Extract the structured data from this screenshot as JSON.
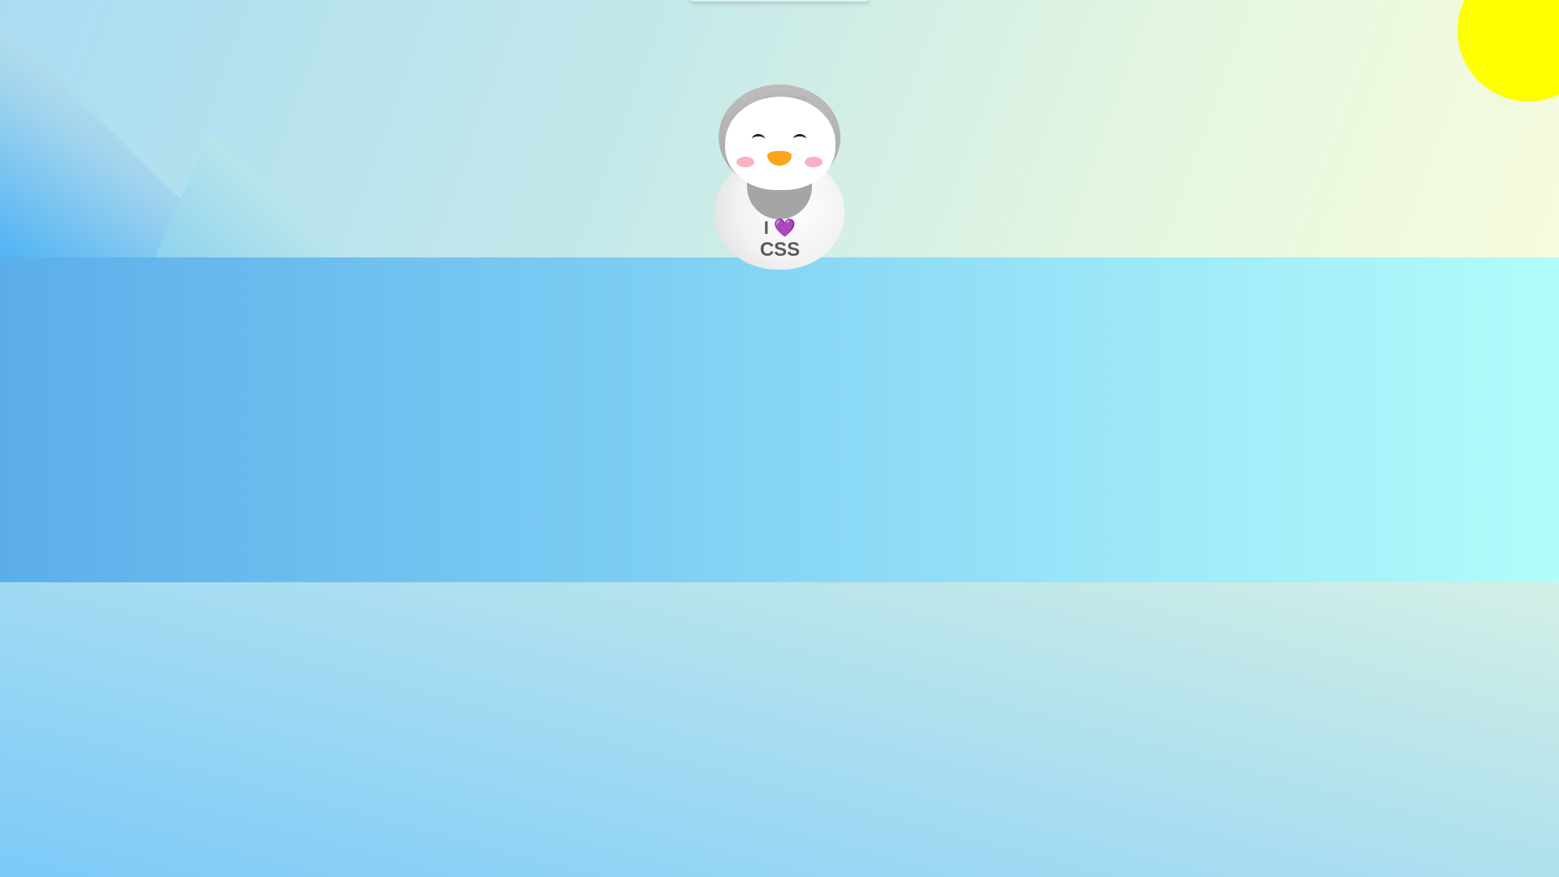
{
  "scene": {
    "colors": {
      "sun": "#ffff00",
      "beak": "#fba518",
      "cheek": "#f7b2c2",
      "heart": "#7b3fd6",
      "band_start": "#5caeea",
      "band_end": "#b2fcfb"
    }
  },
  "penguin": {
    "shirt_line1_text": "I",
    "heart_icon": "💜",
    "shirt_line2_text": "CSS"
  }
}
